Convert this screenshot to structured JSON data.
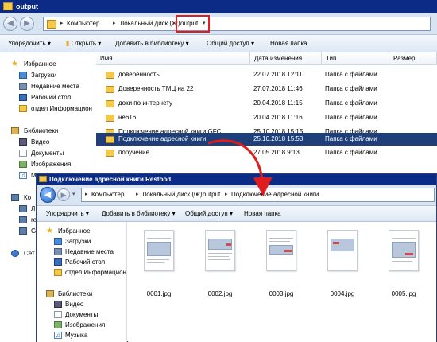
{
  "window1": {
    "title": "output",
    "crumbs": [
      "Компьютер",
      "Локальный диск (C:)",
      "output"
    ],
    "toolbar": [
      "Упорядочить",
      "Открыть",
      "Добавить в библиотеку",
      "Общий доступ",
      "Новая папка"
    ],
    "nav": {
      "favorites": "Избранное",
      "downloads": "Загрузки",
      "recent": "Недавние места",
      "desktop": "Рабочий стол",
      "dept": "отдел Информацион",
      "libraries": "Библиотеки",
      "video": "Видео",
      "documents": "Документы",
      "images": "Изображения",
      "music": "М",
      "computer": "Ко",
      "drive": "Л",
      "r": "re",
      "g": "G",
      "net": "Сет"
    },
    "columns": [
      "Имя",
      "Дата изменения",
      "Тип",
      "Размер"
    ],
    "rows": [
      {
        "name": "доверенность",
        "date": "22.07.2018 12:11",
        "type": "Папка с файлами"
      },
      {
        "name": "Доверенность ТМЦ на 22",
        "date": "27.07.2018 11:46",
        "type": "Папка с файлами"
      },
      {
        "name": "доки по интернету",
        "date": "20.04.2018 11:15",
        "type": "Папка с файлами"
      },
      {
        "name": "не616",
        "date": "20.04.2018 11:16",
        "type": "Папка с файлами"
      },
      {
        "name": "Подключение адресной книги GFC",
        "date": "25.10.2018 15:15",
        "type": "Папка с файлами"
      },
      {
        "name": "Подключение адресной книги",
        "date": "25.10.2018 15:53",
        "type": "Папка с файлами"
      },
      {
        "name": "поручение",
        "date": "27.05.2018 9:13",
        "type": "Папка с файлами"
      }
    ]
  },
  "window2": {
    "title": "Подключение адресной книги Resfood",
    "crumbs": [
      "Компьютер",
      "Локальный диск (C:)",
      "output",
      "Подключение адресной книги"
    ],
    "toolbar": [
      "Упорядочить",
      "Добавить в библиотеку",
      "Общий доступ",
      "Новая папка"
    ],
    "nav": {
      "favorites": "Избранное",
      "downloads": "Загрузки",
      "recent": "Недавние места",
      "desktop": "Рабочий стол",
      "dept": "отдел Информацион",
      "libraries": "Библиотеки",
      "video": "Видео",
      "documents": "Документы",
      "images": "Изображения",
      "music": "Музыка"
    },
    "files": [
      "0001.jpg",
      "0002.jpg",
      "0003.jpg",
      "0004.jpg",
      "0005.jpg"
    ]
  },
  "colors": {
    "title_bar": "#0b2b86",
    "highlight": "#e01c1c",
    "selection": "#1e3f7a"
  }
}
